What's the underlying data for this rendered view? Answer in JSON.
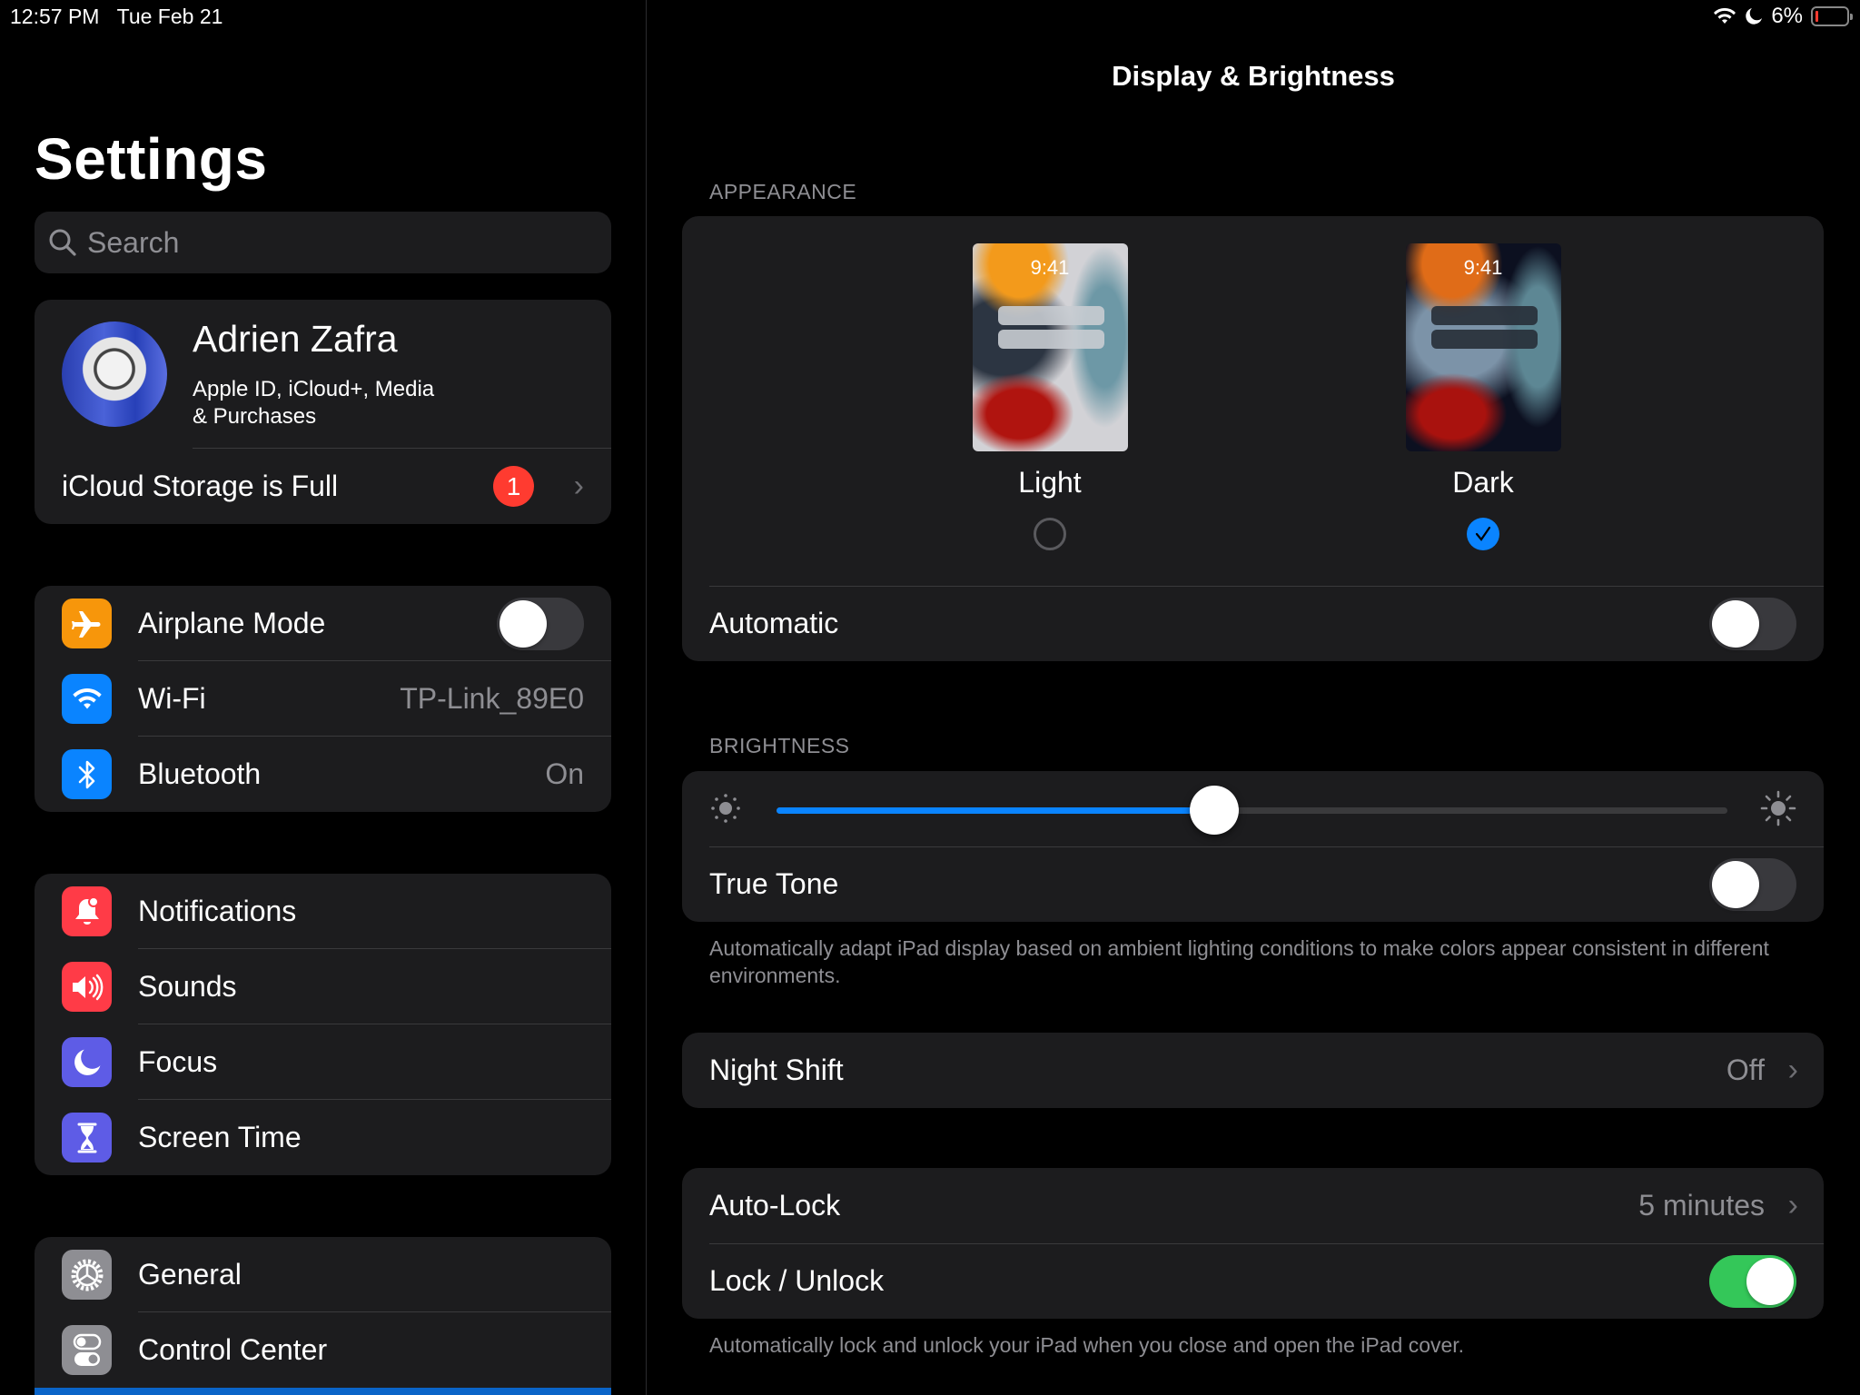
{
  "status_bar": {
    "time": "12:57 PM",
    "date": "Tue Feb 21",
    "battery_percent": "6%",
    "battery_level": 0.06,
    "icons": [
      "wifi-icon",
      "moon-icon",
      "battery-icon"
    ]
  },
  "sidebar": {
    "title": "Settings",
    "search_placeholder": "Search",
    "profile": {
      "name": "Adrien Zafra",
      "subtitle_line1": "Apple ID, iCloud+, Media",
      "subtitle_line2": "& Purchases"
    },
    "icloud_alert": {
      "label": "iCloud Storage is Full",
      "badge": "1"
    },
    "groups": [
      [
        {
          "label": "Airplane Mode",
          "icon": "airplane-icon",
          "color": "#f7960b",
          "toggle": false
        },
        {
          "label": "Wi-Fi",
          "icon": "wifi-icon",
          "color": "#0a84ff",
          "value": "TP-Link_89E0"
        },
        {
          "label": "Bluetooth",
          "icon": "bluetooth-icon",
          "color": "#0a84ff",
          "value": "On"
        }
      ],
      [
        {
          "label": "Notifications",
          "icon": "bell-icon",
          "color": "#ff3b47"
        },
        {
          "label": "Sounds",
          "icon": "speaker-icon",
          "color": "#ff3b47"
        },
        {
          "label": "Focus",
          "icon": "moon-icon",
          "color": "#5e5ce6"
        },
        {
          "label": "Screen Time",
          "icon": "hourglass-icon",
          "color": "#5e5ce6"
        }
      ],
      [
        {
          "label": "General",
          "icon": "gear-icon",
          "color": "#8e8e93"
        },
        {
          "label": "Control Center",
          "icon": "switches-icon",
          "color": "#8e8e93"
        }
      ]
    ]
  },
  "detail": {
    "title": "Display & Brightness",
    "appearance": {
      "header": "APPEARANCE",
      "preview_time": "9:41",
      "options": [
        {
          "label": "Light",
          "selected": false
        },
        {
          "label": "Dark",
          "selected": true
        }
      ],
      "automatic_label": "Automatic",
      "automatic_on": false
    },
    "brightness": {
      "header": "BRIGHTNESS",
      "level": 0.46,
      "true_tone_label": "True Tone",
      "true_tone_on": false,
      "footnote": "Automatically adapt iPad display based on ambient lighting conditions to make colors appear consistent in different environments."
    },
    "night_shift": {
      "label": "Night Shift",
      "value": "Off"
    },
    "auto_lock": {
      "label": "Auto-Lock",
      "value": "5 minutes"
    },
    "lock_unlock": {
      "label": "Lock / Unlock",
      "on": true,
      "footnote": "Automatically lock and unlock your iPad when you close and open the iPad cover."
    }
  }
}
